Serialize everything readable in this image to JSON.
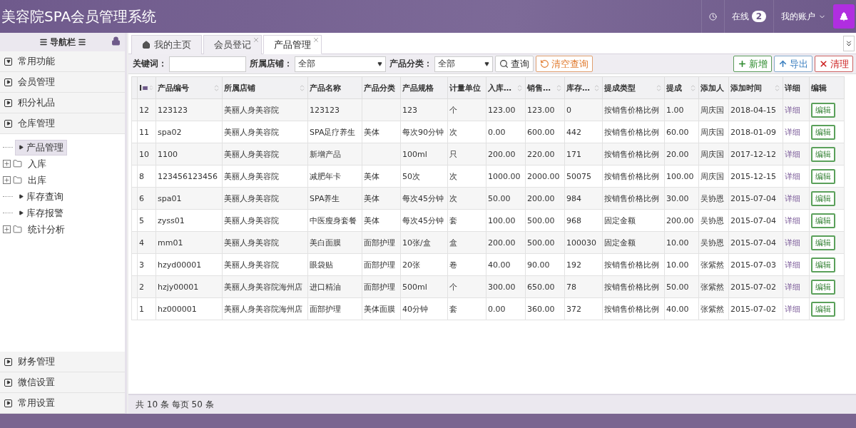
{
  "header": {
    "title": "美容院SPA会员管理系统",
    "online_label": "在线",
    "online_count": "2",
    "account": "我的账户"
  },
  "sidebar": {
    "title": "导航栏",
    "top_sections": [
      {
        "label": "常用功能",
        "expanded": true
      },
      {
        "label": "会员管理",
        "expanded": false
      },
      {
        "label": "积分礼品",
        "expanded": false
      },
      {
        "label": "仓库管理",
        "expanded": false
      }
    ],
    "tree": [
      {
        "label": "产品管理",
        "kind": "leaf",
        "selected": true
      },
      {
        "label": "入库",
        "kind": "folder",
        "selected": false
      },
      {
        "label": "出库",
        "kind": "folder",
        "selected": false
      },
      {
        "label": "库存查询",
        "kind": "leaf",
        "selected": false
      },
      {
        "label": "库存报警",
        "kind": "leaf",
        "selected": false
      },
      {
        "label": "统计分析",
        "kind": "folder",
        "selected": false
      }
    ],
    "bottom_sections": [
      {
        "label": "财务管理",
        "expanded": false
      },
      {
        "label": "微信设置",
        "expanded": false
      },
      {
        "label": "常用设置",
        "expanded": false
      }
    ]
  },
  "tabs": [
    {
      "label": "我的主页",
      "kind": "home",
      "selected": false
    },
    {
      "label": "会员登记",
      "kind": "closable",
      "selected": false
    },
    {
      "label": "产品管理",
      "kind": "closable",
      "selected": true
    }
  ],
  "filters": [
    {
      "label": "关键词：",
      "kind": "text"
    },
    {
      "label": "所属店铺：",
      "kind": "select",
      "value": "全部"
    },
    {
      "label": "产品分类：",
      "kind": "select",
      "value": "全部"
    }
  ],
  "buttons": [
    {
      "label": "查询",
      "kind": "search"
    },
    {
      "label": "清空查询",
      "kind": "reset"
    },
    {
      "label": "新增",
      "kind": "add"
    },
    {
      "label": "导出",
      "kind": "export"
    },
    {
      "label": "清理",
      "kind": "clear"
    }
  ],
  "table": {
    "columns": [
      {
        "label": "I",
        "sortable": true
      },
      {
        "label": "产品编号",
        "sortable": true
      },
      {
        "label": "所属店铺",
        "sortable": true
      },
      {
        "label": "产品名称",
        "sortable": false
      },
      {
        "label": "产品分类",
        "sortable": false
      },
      {
        "label": "产品规格",
        "sortable": false
      },
      {
        "label": "计量单位",
        "sortable": false
      },
      {
        "label": "入库…",
        "sortable": true
      },
      {
        "label": "销售…",
        "sortable": true
      },
      {
        "label": "库存…",
        "sortable": true
      },
      {
        "label": "提成类型",
        "sortable": true
      },
      {
        "label": "提成",
        "sortable": true
      },
      {
        "label": "添加人",
        "sortable": false
      },
      {
        "label": "添加时间",
        "sortable": true
      },
      {
        "label": "详细",
        "sortable": false
      },
      {
        "label": "编辑",
        "sortable": false
      }
    ],
    "rows": [
      [
        "12",
        "123123",
        "美丽人身美容院",
        "123123",
        "",
        "123",
        "个",
        "123.00",
        "123.00",
        "0",
        "按销售价格比例",
        "1.00",
        "周庆国",
        "2018-04-15",
        "详细",
        "编辑"
      ],
      [
        "11",
        "spa02",
        "美丽人身美容院",
        "SPA足疗养生",
        "美体",
        "每次90分钟",
        "次",
        "0.00",
        "600.00",
        "442",
        "按销售价格比例",
        "60.00",
        "周庆国",
        "2018-01-09",
        "详细",
        "编辑"
      ],
      [
        "10",
        "1100",
        "美丽人身美容院",
        "新增产品",
        "",
        "100ml",
        "只",
        "200.00",
        "220.00",
        "171",
        "按销售价格比例",
        "20.00",
        "周庆国",
        "2017-12-12",
        "详细",
        "编辑"
      ],
      [
        "8",
        "123456123456",
        "美丽人身美容院",
        "减肥年卡",
        "美体",
        "50次",
        "次",
        "1000.00",
        "2000.00",
        "50075",
        "按销售价格比例",
        "100.00",
        "周庆国",
        "2015-12-15",
        "详细",
        "编辑"
      ],
      [
        "6",
        "spa01",
        "美丽人身美容院",
        "SPA养生",
        "美体",
        "每次45分钟",
        "次",
        "50.00",
        "200.00",
        "984",
        "按销售价格比例",
        "30.00",
        "吴协恩",
        "2015-07-04",
        "详细",
        "编辑"
      ],
      [
        "5",
        "zyss01",
        "美丽人身美容院",
        "中医瘦身套餐",
        "美体",
        "每次45分钟",
        "套",
        "100.00",
        "500.00",
        "968",
        "固定金额",
        "200.00",
        "吴协恩",
        "2015-07-04",
        "详细",
        "编辑"
      ],
      [
        "4",
        "mm01",
        "美丽人身美容院",
        "美白面膜",
        "面部护理",
        "10张/盒",
        "盒",
        "200.00",
        "500.00",
        "100030",
        "固定金额",
        "10.00",
        "吴协恩",
        "2015-07-04",
        "详细",
        "编辑"
      ],
      [
        "3",
        "hzyd00001",
        "美丽人身美容院",
        "眼袋贴",
        "面部护理",
        "20张",
        "卷",
        "40.00",
        "90.00",
        "192",
        "按销售价格比例",
        "10.00",
        "张紫然",
        "2015-07-03",
        "详细",
        "编辑"
      ],
      [
        "2",
        "hzjy00001",
        "美丽人身美容院海州店",
        "进口精油",
        "面部护理",
        "500ml",
        "个",
        "300.00",
        "650.00",
        "78",
        "按销售价格比例",
        "50.00",
        "张紫然",
        "2015-07-02",
        "详细",
        "编辑"
      ],
      [
        "1",
        "hz000001",
        "美丽人身美容院海州店",
        "面部护理",
        "美体面膜",
        "40分钟",
        "套",
        "0.00",
        "360.00",
        "372",
        "按销售价格比例",
        "40.00",
        "张紫然",
        "2015-07-02",
        "详细",
        "编辑"
      ]
    ]
  },
  "footer": "共 10 条 每页 50 条"
}
